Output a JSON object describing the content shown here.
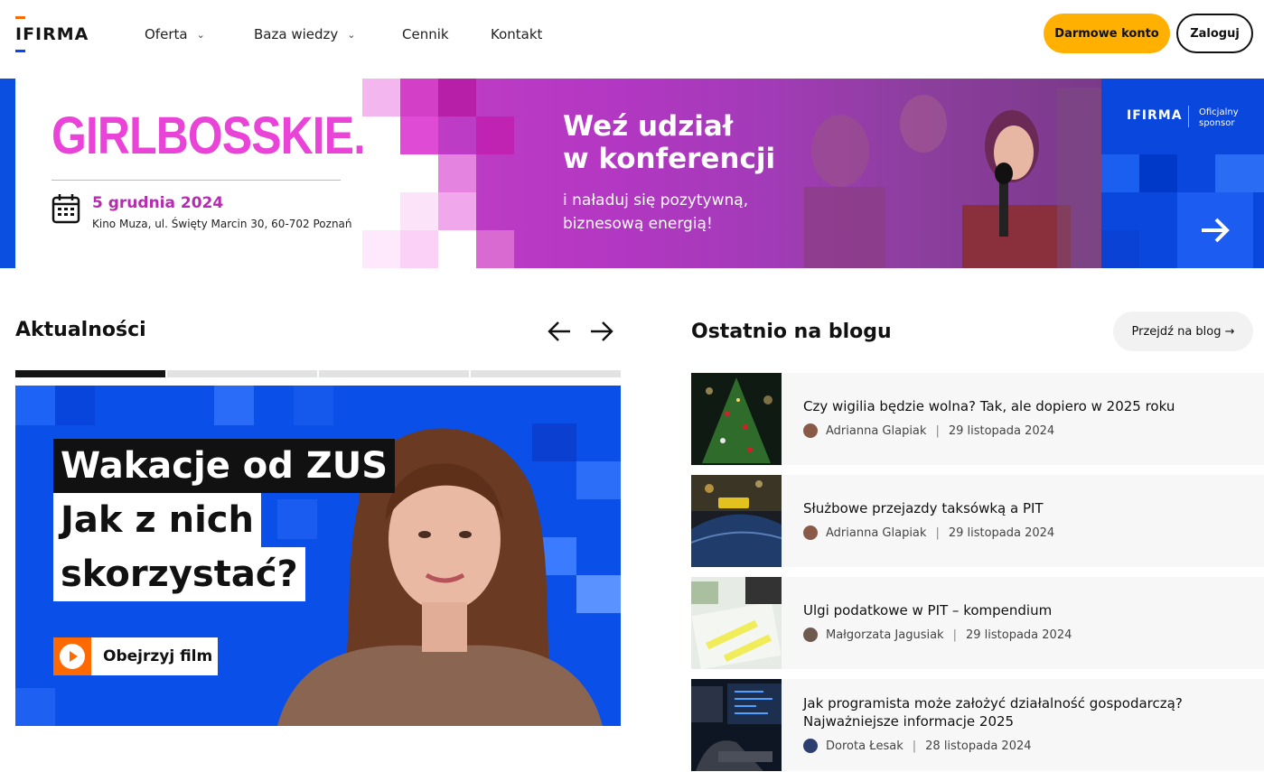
{
  "header": {
    "logo": "IFIRMA",
    "nav": [
      {
        "label": "Oferta",
        "has_dropdown": true
      },
      {
        "label": "Baza wiedzy",
        "has_dropdown": true
      },
      {
        "label": "Cennik",
        "has_dropdown": false
      },
      {
        "label": "Kontakt",
        "has_dropdown": false
      }
    ],
    "free_account_label": "Darmowe konto",
    "login_label": "Zaloguj"
  },
  "banner": {
    "brand": "GIRLBOSSKIE.",
    "date": "5 grudnia 2024",
    "place": "Kino Muza, ul. Święty Marcin 30, 60-702 Poznań",
    "headline_line1": "Weź udział",
    "headline_line2": "w konferencji",
    "sub_line1": "i naładuj się pozytywną,",
    "sub_line2": "biznesową energią!",
    "sponsor_logo": "IFIRMA",
    "sponsor_text_line1": "Oficjalny",
    "sponsor_text_line2": "sponsor"
  },
  "news": {
    "title": "Aktualności",
    "slides_count": 4,
    "active_slide": 1,
    "hero": {
      "line1": "Wakacje od ZUS",
      "line2": "Jak z nich",
      "line3": "skorzystać?",
      "cta": "Obejrzyj film"
    }
  },
  "blog": {
    "title": "Ostatnio na blogu",
    "button": "Przejdź na blog →",
    "posts": [
      {
        "title_line1": "Czy wigilia będzie wolna? Tak, ale dopiero w 2025 roku",
        "title_line2": "",
        "author": "Adrianna Glapiak",
        "date": "29 listopada 2024"
      },
      {
        "title_line1": "Służbowe przejazdy taksówką a PIT",
        "title_line2": "",
        "author": "Adrianna Glapiak",
        "date": "29 listopada 2024"
      },
      {
        "title_line1": "Ulgi podatkowe w PIT – kompendium",
        "title_line2": "",
        "author": "Małgorzata Jagusiak",
        "date": "29 listopada 2024"
      },
      {
        "title_line1": "Jak programista może założyć działalność gospodarczą?",
        "title_line2": "Najważniejsze informacje 2025",
        "author": "Dorota Łesak",
        "date": "28 listopada 2024"
      }
    ]
  },
  "colors": {
    "accent": "#ffb000",
    "brand_blue": "#0a4fe8",
    "banner_pink": "#e943d8",
    "play_orange": "#ff6a00"
  }
}
